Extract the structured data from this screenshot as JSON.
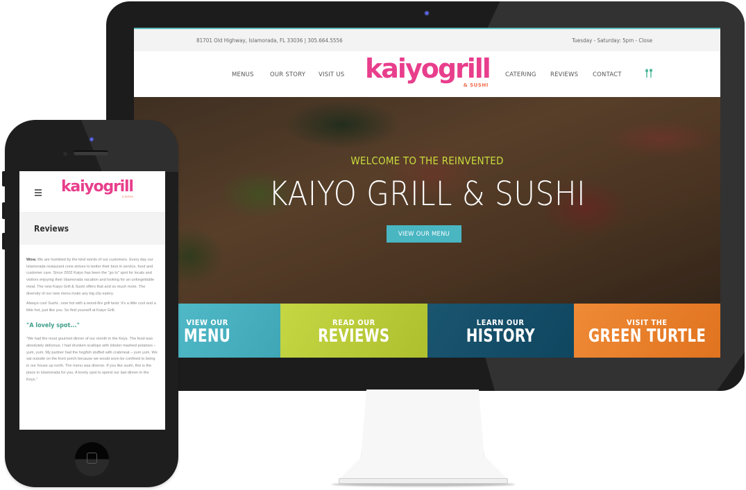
{
  "desktop": {
    "topbar": {
      "address": "81701 Old Highway, Islamorada, FL 33036 | 305.664.5556",
      "hours": "Tuesday - Saturday: 5pm - Close"
    },
    "nav_left": [
      "MENUS",
      "OUR STORY",
      "VISIT US"
    ],
    "nav_right": [
      "CATERING",
      "REVIEWS",
      "CONTACT"
    ],
    "logo": {
      "main": "kaiyogrill",
      "sub": "& SUSHI"
    },
    "nav_icon": "fork-spoon-icon",
    "hero": {
      "subtitle": "WELCOME TO THE REINVENTED",
      "title": "KAIYO GRILL & SUSHI",
      "button": "VIEW OUR MENU"
    },
    "tiles": [
      {
        "pre": "VIEW OUR",
        "big": "MENU",
        "color": "#4ab5c3"
      },
      {
        "pre": "READ OUR",
        "big": "REVIEWS",
        "color": "#bccf3a"
      },
      {
        "pre": "LEARN OUR",
        "big": "HISTORY",
        "color": "#154e69"
      },
      {
        "pre": "VISIT THE",
        "big": "GREEN TURTLE",
        "color": "#ea7f2b"
      }
    ]
  },
  "mobile": {
    "logo": {
      "main": "kaiyogrill",
      "sub": "& SUSHI"
    },
    "page_title": "Reviews",
    "intro_bold": "Wow.",
    "intro": " We are humbled by the kind words of our customers. Every day our Islamorada restaurant crew strives to better their best in service, food and customer care. Since 2002 Kaiyo has been the \"go to\" spot for locals and visitors enjoying their Islamorada vacation and looking for an unforgettable meal. The new Kaiyo Grill & Sushi offers that and so much more. The diversity of our new menu rivals any big city eatery.",
    "para2": "Always cool Sushi...now hot with a wood-fire grill twist. It's a little cool and a little hot, just like you. So find yourself at Kaiyo Grill.",
    "quote_title": "\"A lovely spot...\"",
    "quote": "\"We had the most gourmet dinner of our month in the Keys. The food was absolutely delicious. I had drunken scallops with lobster mashed potatoes – yum, yum. My partner had the hogfish stuffed with crabmeat – yum yum. We sat outside on the front porch because we would soon be confined to being in our house up north. The menu was diverse. If you like sushi, this is the place in Islamorada for you. A lovely spot to spend our last dinner in the Keys.\""
  },
  "colors": {
    "brand_pink": "#e83e8c",
    "accent_teal": "#49b6c2",
    "hero_subtitle": "#c8dc3c",
    "quote_green": "#3e9e8a"
  }
}
